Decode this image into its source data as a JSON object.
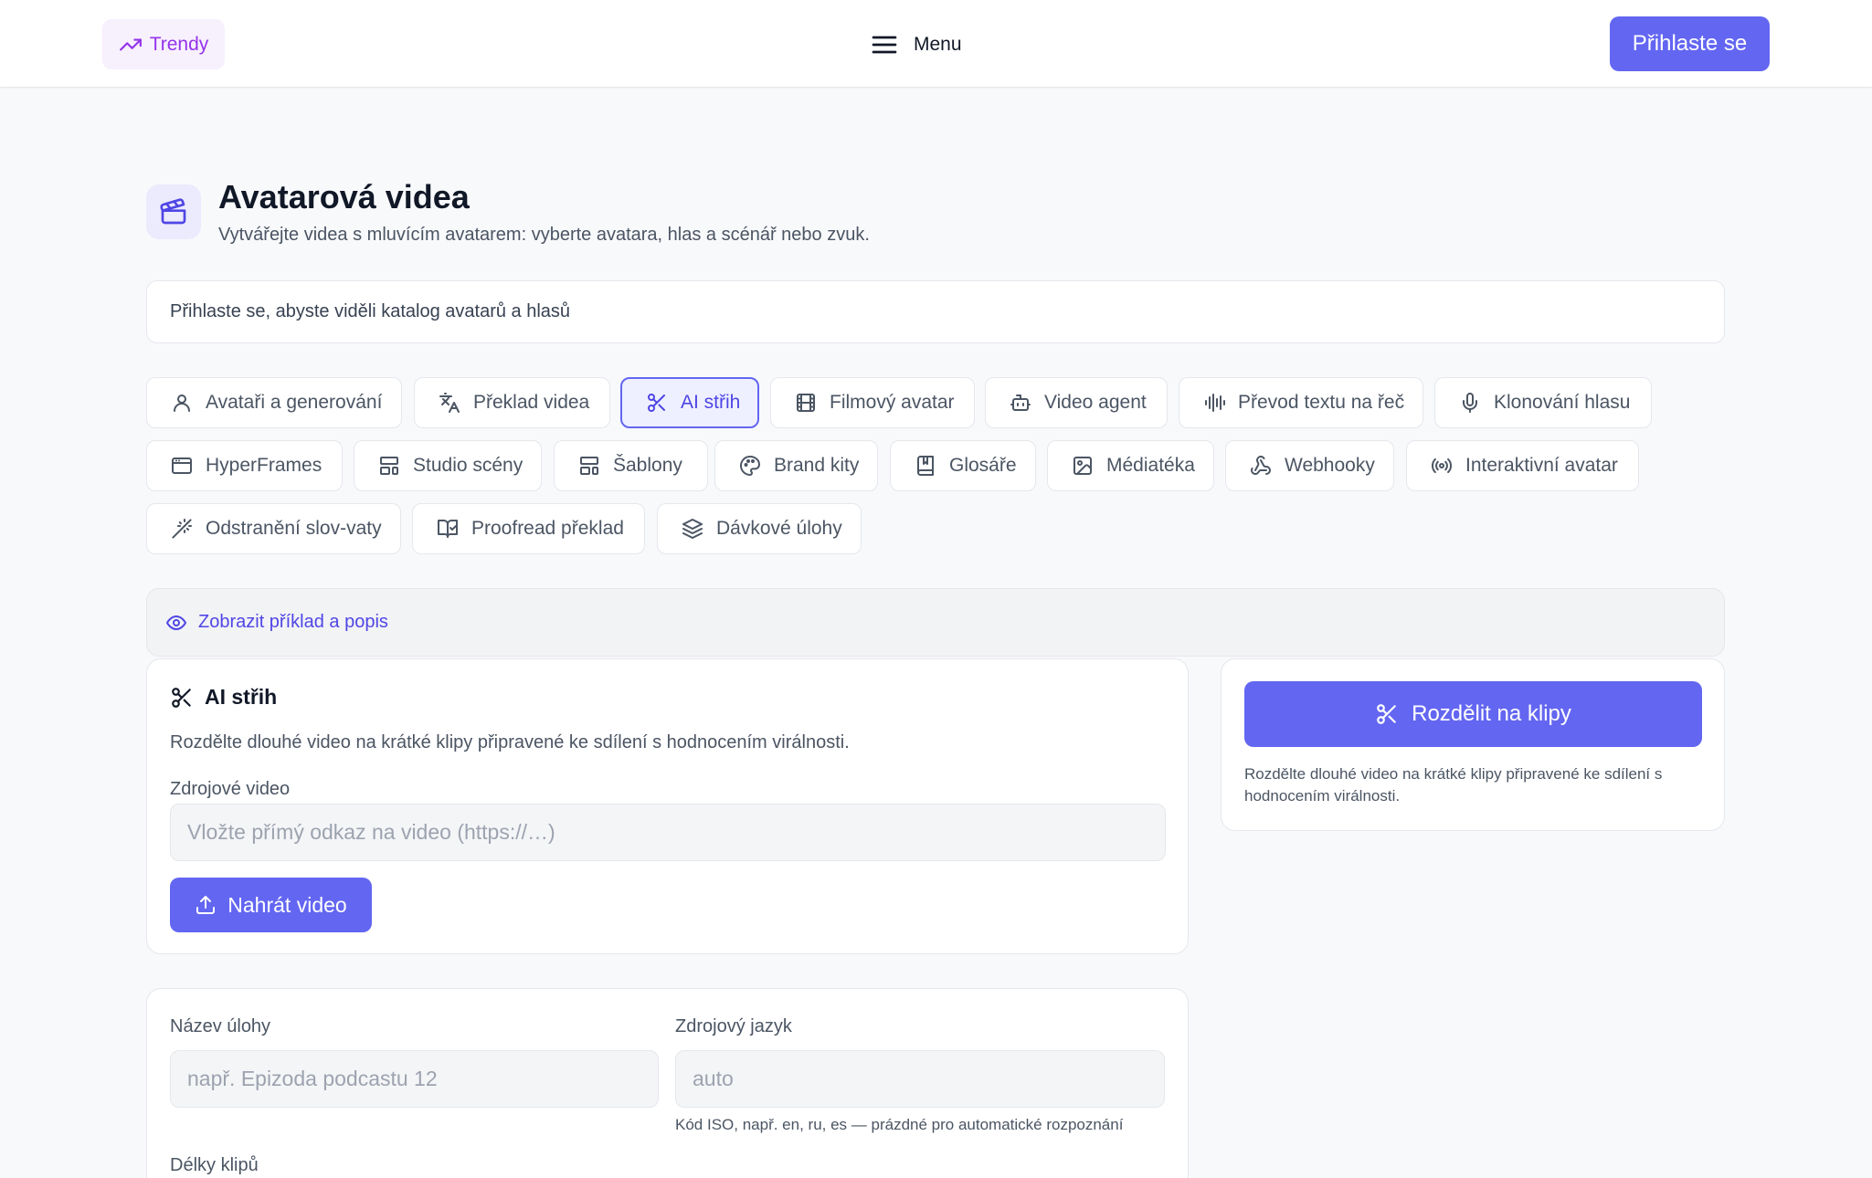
{
  "header": {
    "trendy_label": "Trendy",
    "menu_label": "Menu",
    "login_label": "Přihlaste se"
  },
  "page": {
    "title": "Avatarová videa",
    "subtitle": "Vytvářejte videa s mluvícím avatarem: vyberte avatara, hlas a scénář nebo zvuk.",
    "notice": "Přihlaste se, abyste viděli katalog avatarů a hlasů"
  },
  "tabs": [
    {
      "label": "Avataři a generování",
      "icon": "user-icon"
    },
    {
      "label": "Překlad videa",
      "icon": "translate-icon"
    },
    {
      "label": "AI střih",
      "icon": "scissors-icon",
      "active": true
    },
    {
      "label": "Filmový avatar",
      "icon": "film-icon"
    },
    {
      "label": "Video agent",
      "icon": "bot-icon"
    },
    {
      "label": "Převod textu na řeč",
      "icon": "audio-waveform-icon"
    },
    {
      "label": "Klonování hlasu",
      "icon": "microphone-icon"
    },
    {
      "label": "HyperFrames",
      "icon": "browser-window-icon"
    },
    {
      "label": "Studio scény",
      "icon": "layout-icon"
    },
    {
      "label": "Šablony",
      "icon": "template-icon"
    },
    {
      "label": "Brand kity",
      "icon": "palette-icon"
    },
    {
      "label": "Glosáře",
      "icon": "book-bookmark-icon"
    },
    {
      "label": "Médiatéka",
      "icon": "image-icon"
    },
    {
      "label": "Webhooky",
      "icon": "webhook-icon"
    },
    {
      "label": "Interaktivní avatar",
      "icon": "broadcast-icon"
    },
    {
      "label": "Odstranění slov-vaty",
      "icon": "magic-wand-icon"
    },
    {
      "label": "Proofread překlad",
      "icon": "book-check-icon"
    },
    {
      "label": "Dávkové úlohy",
      "icon": "layers-icon"
    }
  ],
  "example": {
    "label": "Zobrazit příklad a popis"
  },
  "cut_card": {
    "title": "AI střih",
    "description": "Rozdělte dlouhé video na krátké klipy připravené ke sdílení s hodnocením virálnosti.",
    "source_label": "Zdrojové video",
    "source_placeholder": "Vložte přímý odkaz na video (https://…)",
    "upload_label": "Nahrát video"
  },
  "side_card": {
    "button_label": "Rozdělit na klipy",
    "note": "Rozdělte dlouhé video na krátké klipy připravené ke sdílení s hodnocením virálnosti."
  },
  "task_card": {
    "name_label": "Název úlohy",
    "name_placeholder": "např. Epizoda podcastu 12",
    "lang_label": "Zdrojový jazyk",
    "lang_placeholder": "auto",
    "lang_hint": "Kód ISO, např. en, ru, es — prázdné pro automatické rozpoznání",
    "lengths_label": "Délky klipů"
  },
  "colors": {
    "accent": "#6366f1",
    "accent_text": "#4f46e5",
    "trendy": "#9333ea"
  }
}
